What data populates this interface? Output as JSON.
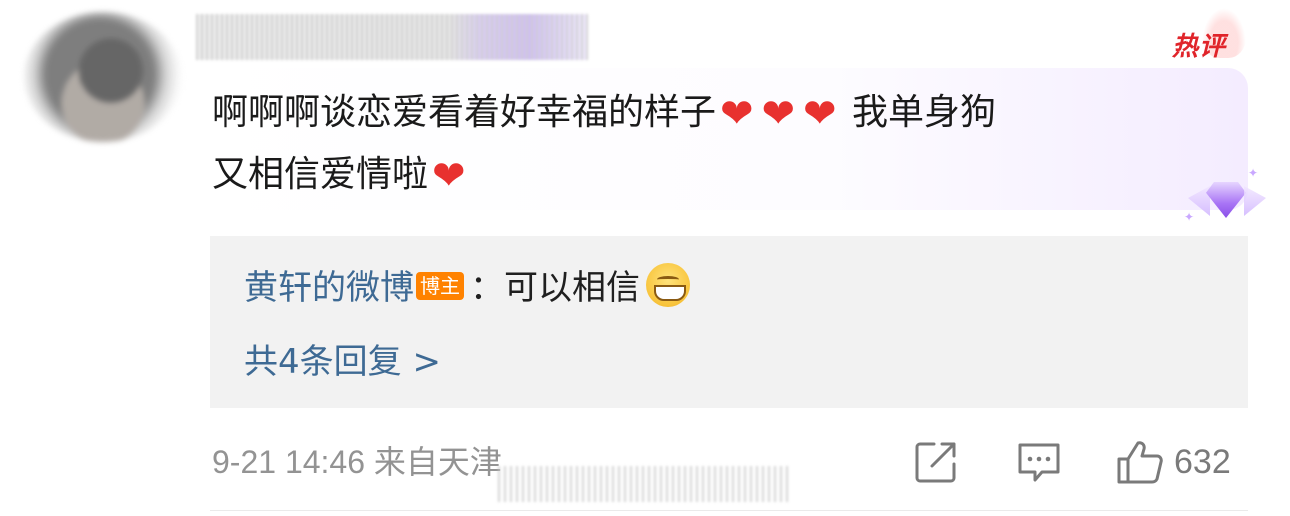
{
  "hot_badge": "热评",
  "comment": {
    "text_line1": "啊啊啊谈恋爱看着好幸福的样子",
    "heart": "❤",
    "text_line1_tail": "我单身狗",
    "text_line2": "又相信爱情啦"
  },
  "reply": {
    "user": "黄轩的微博",
    "role_badge": "博主",
    "separator": "：",
    "text": "可以相信",
    "more_label": "共4条回复 >"
  },
  "meta": {
    "datetime": "9-21 14:46",
    "location": "来自天津"
  },
  "actions": {
    "like_count": "632"
  },
  "icons": [
    "avatar",
    "hot-flame-icon",
    "heart-emoji",
    "gem-badge-icon",
    "grin-emoji",
    "share-icon",
    "comment-icon",
    "like-icon"
  ],
  "colors": {
    "link_blue": "#3e6a94",
    "hot_red": "#e0242a",
    "badge_orange": "#ff8200",
    "meta_gray": "#939393"
  }
}
